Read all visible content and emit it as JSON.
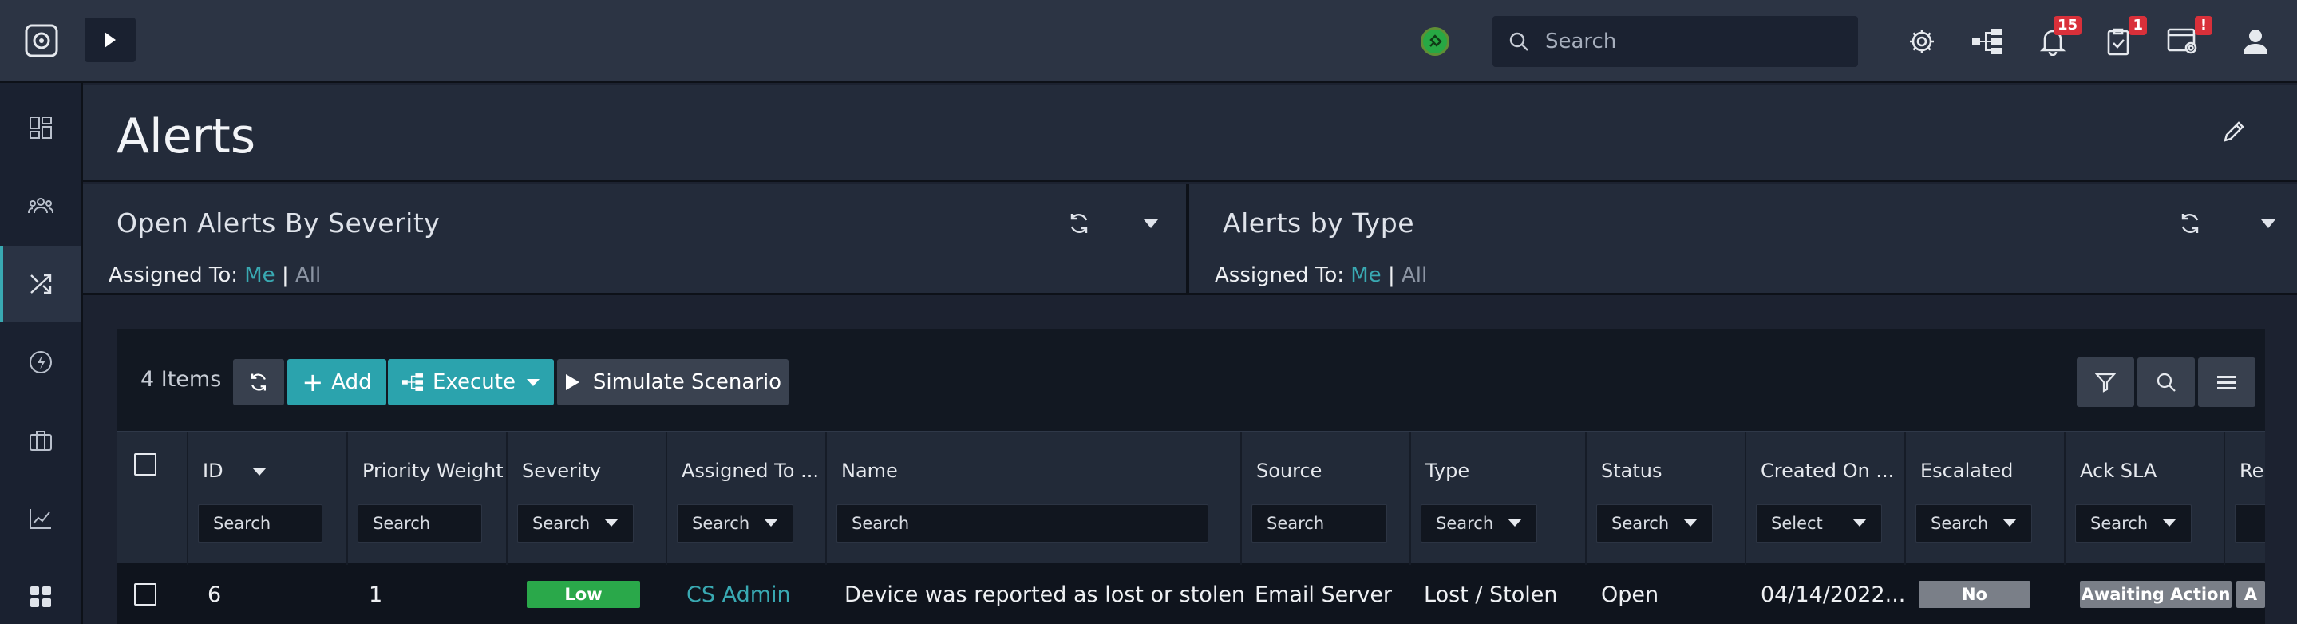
{
  "topbar": {
    "search_placeholder": "Search",
    "notifications_count": "15",
    "tasks_count": "1",
    "system_alert": "!"
  },
  "page": {
    "title": "Alerts"
  },
  "widgets": [
    {
      "title": "Open Alerts By Severity",
      "assigned_label": "Assigned To:",
      "me": "Me",
      "sep": "|",
      "all": "All"
    },
    {
      "title": "Alerts by Type",
      "assigned_label": "Assigned To:",
      "me": "Me",
      "sep": "|",
      "all": "All"
    }
  ],
  "grid": {
    "count_label": "4 Items",
    "add_label": "Add",
    "execute_label": "Execute",
    "simulate_label": "Simulate Scenario",
    "columns": [
      {
        "label": "ID",
        "filter": "Search"
      },
      {
        "label": "Priority Weight ...",
        "filter": "Search"
      },
      {
        "label": "Severity",
        "filter": "Search"
      },
      {
        "label": "Assigned To ...",
        "filter": "Search"
      },
      {
        "label": "Name",
        "filter": "Search"
      },
      {
        "label": "Source",
        "filter": "Search"
      },
      {
        "label": "Type",
        "filter": "Search"
      },
      {
        "label": "Status",
        "filter": "Search"
      },
      {
        "label": "Created On ...",
        "filter": "Select"
      },
      {
        "label": "Escalated",
        "filter": "Search"
      },
      {
        "label": "Ack SLA",
        "filter": "Search"
      },
      {
        "label": "Re",
        "filter": ""
      }
    ],
    "rows": [
      {
        "id": "6",
        "priority_weight": "1",
        "severity": "Low",
        "assigned_to": "CS Admin",
        "name": "Device was reported as lost or stolen",
        "source": "Email Server",
        "type": "Lost / Stolen",
        "status": "Open",
        "created_on": "04/14/2022...",
        "escalated": "No",
        "ack_sla": "Awaiting Action",
        "resp_sla": "A"
      }
    ]
  },
  "colors": {
    "accent": "#39a9b2",
    "severity_low": "#2aa84a",
    "escalated_no": "#7a7f88",
    "badge": "#d9303a"
  }
}
